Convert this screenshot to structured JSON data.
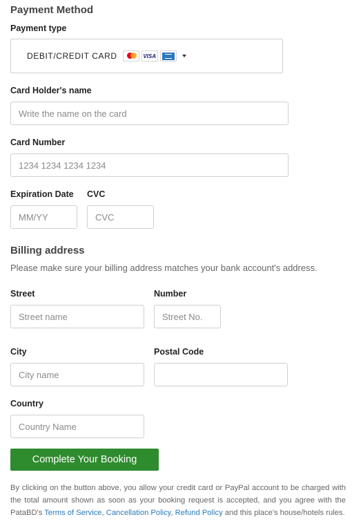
{
  "payment": {
    "heading": "Payment Method",
    "type_label": "Payment type",
    "type_value": "DEBIT/CREDIT CARD",
    "card_icons": [
      "mastercard-icon",
      "visa-icon",
      "amex-icon"
    ],
    "visa_text": "VISA"
  },
  "holder": {
    "label": "Card Holder's name",
    "placeholder": "Write the name on the card"
  },
  "card_number": {
    "label": "Card Number",
    "placeholder": "1234 1234 1234 1234"
  },
  "expiry": {
    "label": "Expiration Date",
    "placeholder": "MM/YY"
  },
  "cvc": {
    "label": "CVC",
    "placeholder": "CVC"
  },
  "billing": {
    "heading": "Billing address",
    "description": "Please make sure your billing address matches your bank account's address."
  },
  "street": {
    "label": "Street",
    "placeholder": "Street name"
  },
  "number": {
    "label": "Number",
    "placeholder": "Street No."
  },
  "city": {
    "label": "City",
    "placeholder": "City name"
  },
  "postal": {
    "label": "Postal Code",
    "placeholder": ""
  },
  "country": {
    "label": "Country",
    "placeholder": "Country Name"
  },
  "submit": {
    "label": "Complete Your Booking"
  },
  "terms": {
    "prefix": "By clicking on the button above, you allow your credit card or PayPal account to be charged with the total amount shown as soon as your booking request is accepted, and you agree with the PataBD's ",
    "tos": "Terms of Service",
    "sep1": ", ",
    "cancellation": "Cancellation Policy",
    "sep2": ", ",
    "refund": "Refund Policy",
    "suffix": " and this place's house/hotels rules."
  },
  "colors": {
    "button": "#2e8b2e",
    "link": "#2a7ab8",
    "border": "#cfcfcf"
  }
}
